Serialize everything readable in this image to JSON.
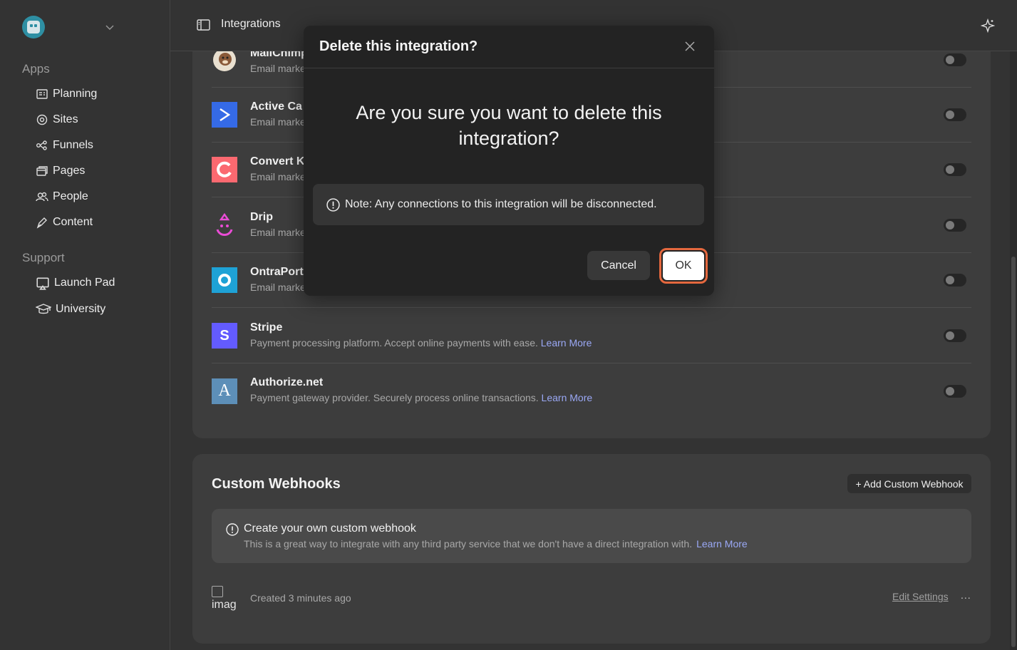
{
  "sidebar": {
    "groups": [
      {
        "title": "Apps",
        "items": [
          {
            "label": "Planning",
            "icon": "planning-icon"
          },
          {
            "label": "Sites",
            "icon": "sites-icon"
          },
          {
            "label": "Funnels",
            "icon": "funnels-icon"
          },
          {
            "label": "Pages",
            "icon": "pages-icon"
          },
          {
            "label": "People",
            "icon": "people-icon"
          },
          {
            "label": "Content",
            "icon": "content-icon"
          }
        ]
      },
      {
        "title": "Support",
        "items": [
          {
            "label": "Launch Pad",
            "icon": "launch-pad-icon"
          },
          {
            "label": "University",
            "icon": "university-icon"
          }
        ]
      }
    ]
  },
  "header": {
    "title": "Integrations"
  },
  "integrations": [
    {
      "name": "MailChimp",
      "desc": "Email marke",
      "logo_color": "#e8e2d6"
    },
    {
      "name": "Active Ca",
      "desc": "Email marke",
      "logo_color": "#356ae6"
    },
    {
      "name": "Convert K",
      "desc": "Email marke",
      "logo_color": "#fb6970"
    },
    {
      "name": "Drip",
      "desc": "Email marke",
      "logo_color": "#ea4cd6"
    },
    {
      "name": "OntraPort",
      "desc": "Email marke",
      "logo_color": "#1ea2d6"
    },
    {
      "name": "Stripe",
      "desc": "Payment processing platform. Accept online payments with ease.",
      "link": "Learn More",
      "logo_color": "#635bff",
      "logo_letter": "S"
    },
    {
      "name": "Authorize.net",
      "desc": "Payment gateway provider. Securely process online transactions.",
      "link": "Learn More",
      "logo_color": "#5d8fb8",
      "logo_letter": "A"
    }
  ],
  "webhooks": {
    "title": "Custom Webhooks",
    "add_label": "+ Add Custom Webhook",
    "info_title": "Create your own custom webhook",
    "info_desc": "This is a great way to integrate with any third party service that we don't have a direct integration with.",
    "info_link": "Learn More",
    "item_img_alt": "imag",
    "item_created": "Created 3 minutes ago",
    "item_edit": "Edit Settings",
    "item_more": "..."
  },
  "modal": {
    "title": "Delete this integration?",
    "question": "Are you sure you want to delete this integration?",
    "note": "Note: Any connections to this integration will be disconnected.",
    "cancel": "Cancel",
    "ok": "OK"
  },
  "colors": {
    "accent_link": "#9aa8f5",
    "ok_focus_ring": "#e4683e"
  }
}
